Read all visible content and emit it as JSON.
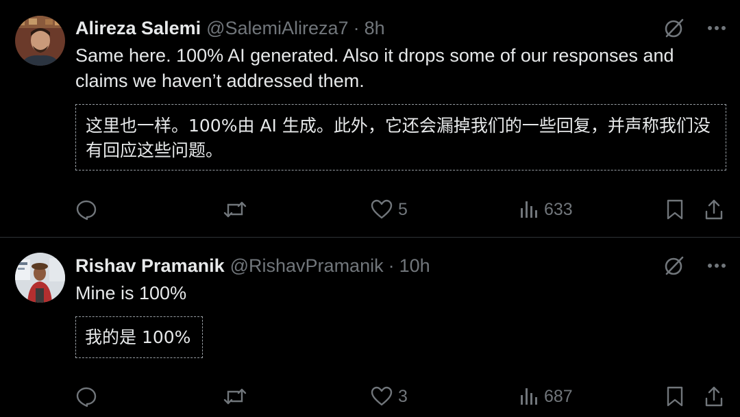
{
  "theme": {
    "background": "#000000",
    "text": "#e7e9ea",
    "muted": "#71767b",
    "divider": "#2f3336"
  },
  "tweets": [
    {
      "author_name": "Alireza Salemi",
      "handle": "@SalemiAlireza7",
      "separator": "·",
      "time": "8h",
      "text": "Same here. 100% AI generated. Also it drops some of our responses and claims we haven’t addressed them.",
      "translation": "这里也一样。100%由 AI 生成。此外，它还会漏掉我们的一些回复，并声称我们没有回应这些问题。",
      "actions": {
        "reply_icon": "reply-icon",
        "retweet_icon": "retweet-icon",
        "like_icon": "heart-icon",
        "like_count": "5",
        "views_icon": "views-chart-icon",
        "views_count": "633",
        "bookmark_icon": "bookmark-icon",
        "share_icon": "share-icon"
      }
    },
    {
      "author_name": "Rishav Pramanik",
      "handle": "@RishavPramanik",
      "separator": "·",
      "time": "10h",
      "text": "Mine is 100%",
      "translation": "我的是 100%",
      "actions": {
        "reply_icon": "reply-icon",
        "retweet_icon": "retweet-icon",
        "like_icon": "heart-icon",
        "like_count": "3",
        "views_icon": "views-chart-icon",
        "views_count": "687",
        "bookmark_icon": "bookmark-icon",
        "share_icon": "share-icon"
      }
    }
  ]
}
